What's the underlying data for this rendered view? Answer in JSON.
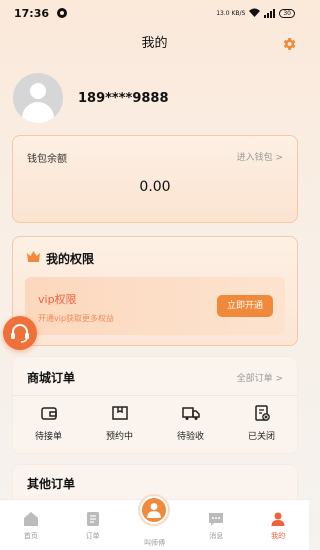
{
  "status_bar": {
    "time": "17:36",
    "speed": "13.0 KB/S",
    "battery": "30"
  },
  "header": {
    "title": "我的"
  },
  "profile": {
    "phone": "189****9888"
  },
  "wallet": {
    "label": "钱包余额",
    "link": "进入钱包 >",
    "balance": "0.00"
  },
  "rights": {
    "title": "我的权限",
    "vip_title": "vip权限",
    "vip_subtitle": "开通vip获取更多权益",
    "vip_button": "立即开通"
  },
  "orders": {
    "title": "商城订单",
    "link": "全部订单 >",
    "items": [
      {
        "label": "待接单",
        "icon": "wallet-icon"
      },
      {
        "label": "预约中",
        "icon": "box-icon"
      },
      {
        "label": "待验收",
        "icon": "truck-icon"
      },
      {
        "label": "已关闭",
        "icon": "closed-doc-icon"
      }
    ]
  },
  "other_orders": {
    "title": "其他订单"
  },
  "tabbar": {
    "items": [
      {
        "label": "首页",
        "icon": "home-icon"
      },
      {
        "label": "订单",
        "icon": "order-icon"
      },
      {
        "label": "叫师傅",
        "icon": "worker-icon"
      },
      {
        "label": "消息",
        "icon": "message-icon"
      },
      {
        "label": "我的",
        "icon": "profile-icon",
        "active": true
      }
    ]
  },
  "colors": {
    "accent": "#f08a3a",
    "vip_red": "#f0603a",
    "tab_active": "#f0603a"
  }
}
